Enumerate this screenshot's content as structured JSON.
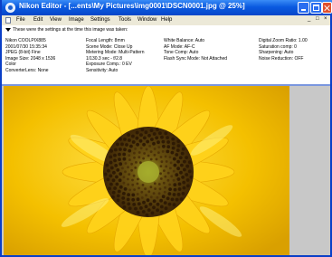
{
  "window": {
    "title": "Nikon Editor - [...ents\\My Pictures\\img0001\\DSCN0001.jpg @ 25%]"
  },
  "menubar": {
    "items": [
      "File",
      "Edit",
      "View",
      "Image",
      "Settings",
      "Tools",
      "Window",
      "Help"
    ],
    "window_controls": [
      "_",
      "□",
      "×"
    ]
  },
  "info": {
    "header": "These were the settings at the time this image was taken:",
    "col1": [
      "Nikon COOLPIX885",
      "2001/07/30 15:35:34",
      "JPEG (8-bit) Fine",
      "Image Size:  2048 x 1536",
      "Color",
      "ConverterLens: None"
    ],
    "col2": [
      "Focal Length: 8mm",
      "Scene Mode: Close Up",
      "Metering Mode: Multi-Pattern",
      "1/130.3 sec - f/2.8",
      "Exposure Comp.: 0 EV",
      "Sensitivity: Auto"
    ],
    "col3": [
      "White Balance: Auto",
      "AF Mode: AF-C",
      "Tone Comp: Auto",
      "Flash Sync Mode: Not Attached"
    ],
    "col4": [
      "Digital Zoom Ratio: 1.00",
      "Saturation comp: 0",
      "Sharpening: Auto",
      "Noise Reduction: OFF"
    ]
  },
  "image": {
    "subject": "sunflower close-up",
    "colors": {
      "petal": "#f2c200",
      "petal_light": "#ffe24a",
      "center": "#5a3a08",
      "seeds": "#3a2004",
      "background": "#c8c8c8"
    }
  }
}
